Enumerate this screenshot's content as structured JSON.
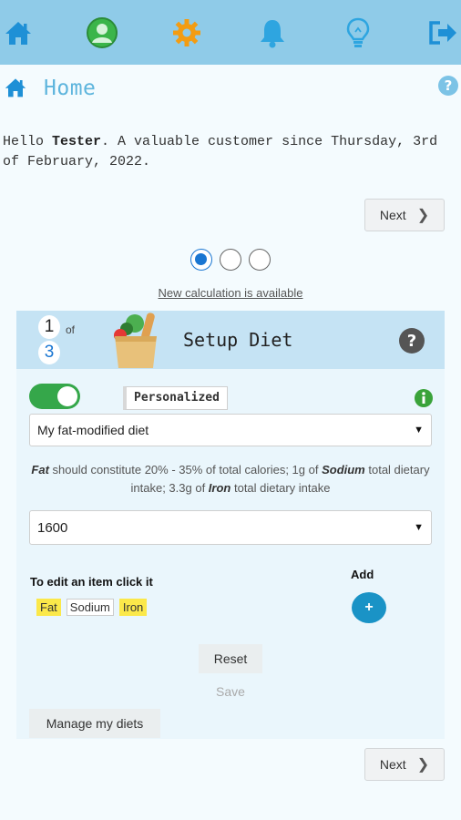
{
  "topbar": {
    "icons": [
      "home-icon",
      "user-profile-icon",
      "settings-gear-icon",
      "notification-bell-icon",
      "lightbulb-icon",
      "logout-icon"
    ],
    "colors": {
      "bar": "#8fcbe8",
      "home": "#1e90d6",
      "user": "#3bb54a",
      "gear": "#f39c12",
      "bell": "#2ea5e0"
    }
  },
  "header": {
    "title": "Home"
  },
  "greeting": {
    "prefix": "Hello ",
    "name": "Tester",
    "suffix": ". A valuable customer since Thursday, 3rd of February, 2022."
  },
  "next_label": "Next",
  "pagination": {
    "total": 3,
    "active": 1
  },
  "new_calc_link": "New calculation is available",
  "card": {
    "step_current": "1",
    "step_of": "of",
    "step_total": "3",
    "title": "Setup Diet",
    "toggle_on": true,
    "mode_label": "Personalized",
    "diet_select": "My fat-modified diet",
    "description": {
      "p1": "Fat",
      "p2": " should constitute 20% - 35% of total calories; 1g of ",
      "p3": "Sodium",
      "p4": " total dietary intake; 3.3g of ",
      "p5": "Iron",
      "p6": " total dietary intake"
    },
    "calories_select": "1600",
    "edit_label": "To edit an item click it",
    "add_label": "Add",
    "add_button": "+",
    "chips": [
      {
        "label": "Fat",
        "highlighted": true
      },
      {
        "label": "Sodium",
        "highlighted": false
      },
      {
        "label": "Iron",
        "highlighted": true
      }
    ],
    "reset_label": "Reset",
    "save_label": "Save",
    "manage_label": "Manage my diets"
  }
}
